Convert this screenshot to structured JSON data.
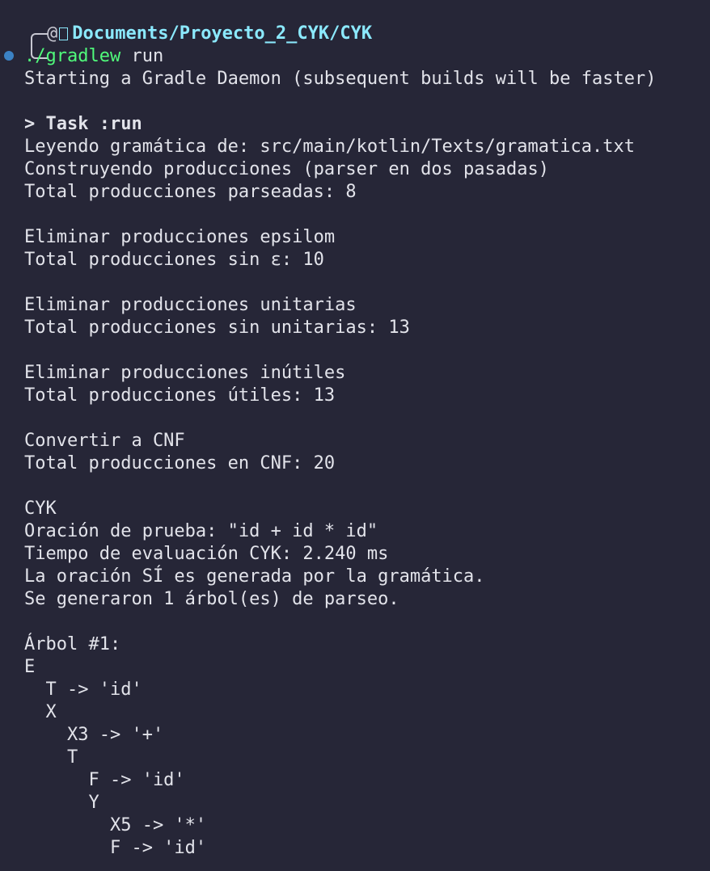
{
  "prompt": {
    "user_symbol": "@",
    "folder_icon": "folder-icon",
    "path": "Documents/Proyecto_2_CYK/CYK",
    "command": "./gradlew",
    "command_arg": " run"
  },
  "output": {
    "daemon": "Starting a Gradle Daemon (subsequent builds will be faster)",
    "task": "> Task :run",
    "lines": {
      "l1": "Leyendo gramática de: src/main/kotlin/Texts/gramatica.txt",
      "l2": "Construyendo producciones (parser en dos pasadas)",
      "l3": "Total producciones parseadas: 8",
      "l4": "Eliminar producciones epsilom",
      "l5": "Total producciones sin ε: 10",
      "l6": "Eliminar producciones unitarias",
      "l7": "Total producciones sin unitarias: 13",
      "l8": "Eliminar producciones inútiles",
      "l9": "Total producciones útiles: 13",
      "l10": "Convertir a CNF",
      "l11": "Total producciones en CNF: 20",
      "l12": "CYK",
      "l13": "Oración de prueba: \"id + id * id\"",
      "l14": "Tiempo de evaluación CYK: 2.240 ms",
      "l15": "La oración SÍ es generada por la gramática.",
      "l16": "Se generaron 1 árbol(es) de parseo.",
      "l17": "Árbol #1:"
    },
    "tree": {
      "t1": "E",
      "t2": "  T -> 'id'",
      "t3": "  X",
      "t4": "    X3 -> '+'",
      "t5": "    T",
      "t6": "      F -> 'id'",
      "t7": "      Y",
      "t8": "        X5 -> '*'",
      "t9": "        F -> 'id'"
    }
  },
  "colors": {
    "background": "#262637",
    "path": "#8be9fd",
    "command": "#50fa7b",
    "text": "#e2e3ea",
    "status_dot": "#3b82c4"
  }
}
